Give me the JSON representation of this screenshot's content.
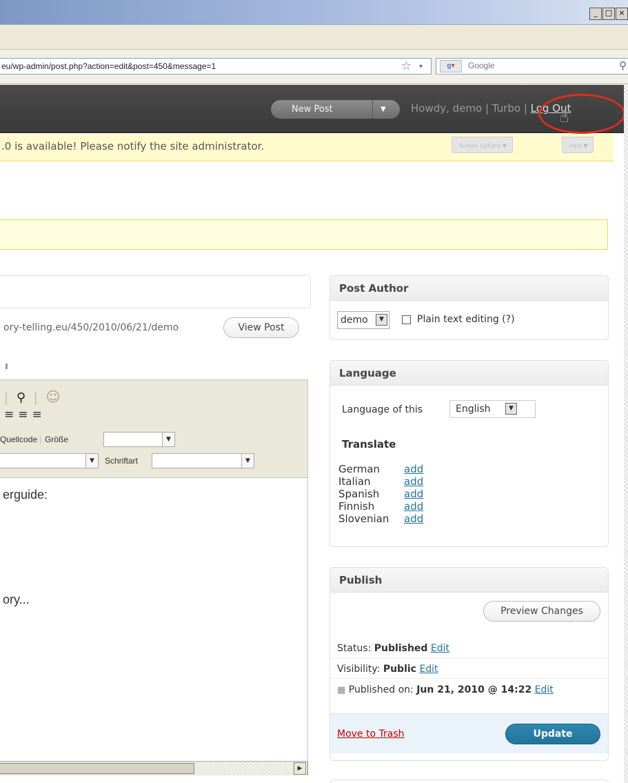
{
  "browser": {
    "window_controls": [
      "_",
      "□",
      "×"
    ],
    "address": "eu/wp-admin/post.php?action=edit&post=450&message=1",
    "search_placeholder": "Google"
  },
  "header": {
    "new_post": "New Post",
    "howdy": "Howdy, demo | Turbo | ",
    "logout": "Log Out"
  },
  "nag": {
    "text": ".0 is available! Please notify the site administrator.",
    "screen_options": "Screen Options",
    "help": "Help"
  },
  "post": {
    "permalink": "ory-telling.eu/450/2010/06/21/demo",
    "view_post": "View Post"
  },
  "editor_toolbar": {
    "source_label": "Quellcode",
    "size_label": "Größe",
    "font_label": "Schriftart"
  },
  "editor": {
    "line1": "erguide:",
    "line2": "ory..."
  },
  "post_author": {
    "title": "Post Author",
    "author": "demo",
    "plain_text": "Plain text editing (?)"
  },
  "language": {
    "title": "Language",
    "label": "Language of this",
    "selected": "English",
    "translate": "Translate",
    "items": [
      {
        "name": "German",
        "action": "add"
      },
      {
        "name": "Italian",
        "action": "add"
      },
      {
        "name": "Spanish",
        "action": "add"
      },
      {
        "name": "Finnish",
        "action": "add"
      },
      {
        "name": "Slovenian",
        "action": "add"
      }
    ]
  },
  "publish": {
    "title": "Publish",
    "preview": "Preview Changes",
    "status_label": "Status: ",
    "status_value": "Published",
    "visibility_label": "Visibility: ",
    "visibility_value": "Public",
    "published_label": "Published on: ",
    "published_value": "Jun 21, 2010 @ 14:22",
    "edit": "Edit",
    "trash": "Move to Trash",
    "update": "Update"
  }
}
